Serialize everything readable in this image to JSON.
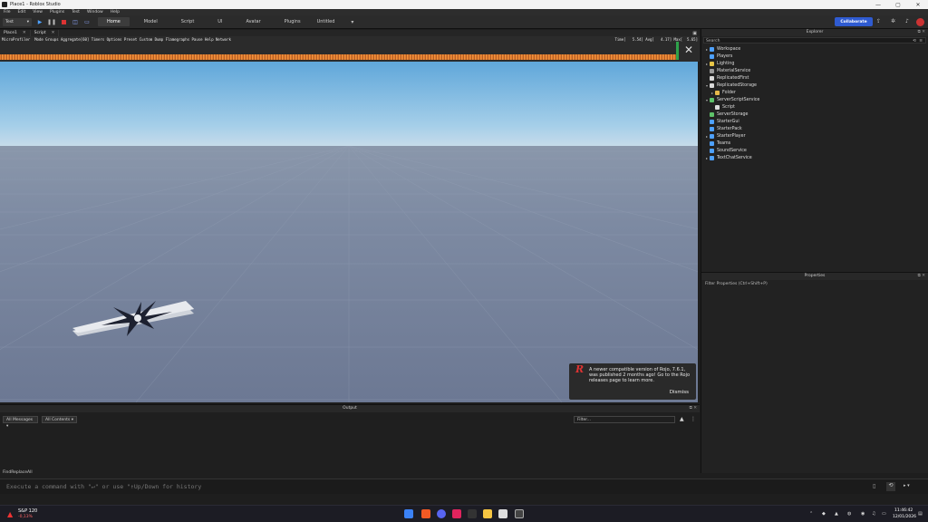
{
  "window": {
    "title": "Place1 - Roblox Studio",
    "controls": [
      "—",
      "▢",
      "✕"
    ]
  },
  "menu": [
    "File",
    "Edit",
    "View",
    "Plugins",
    "Test",
    "Window",
    "Help"
  ],
  "toolbar": {
    "mode": "Test",
    "tabs": [
      "Home",
      "Model",
      "Script",
      "UI",
      "Avatar",
      "Plugins",
      "Untitled"
    ],
    "active_tab": "Home",
    "collaborate": "Collaborate"
  },
  "doc_tabs": [
    {
      "label": "Place1"
    },
    {
      "label": "Script"
    }
  ],
  "microprofiler": {
    "menu": "MicroProfiler  Mode Groups Aggregate[60] Timers Options Preset Custom Dump Flamegraphs Pause Help Network",
    "stats": "Time[   5.54] Avg[   4.17] Max[  5.65]"
  },
  "rojo": {
    "logo": "R",
    "message": "A newer compatible version of Rojo, 7.6.1, was published 2 months ago! Go to the Rojo releases page to learn more.",
    "dismiss": "Dismiss"
  },
  "explorer": {
    "title": "Explorer",
    "search_placeholder": "Search",
    "items": [
      {
        "label": "Workspace",
        "arrow": "▸",
        "color": "#4ea1ff"
      },
      {
        "label": "Players",
        "arrow": "",
        "color": "#4ea1ff"
      },
      {
        "label": "Lighting",
        "arrow": "▸",
        "color": "#e8c547"
      },
      {
        "label": "MaterialService",
        "arrow": "",
        "color": "#9b9b9b"
      },
      {
        "label": "ReplicatedFirst",
        "arrow": "",
        "color": "#d9d9d9"
      },
      {
        "label": "ReplicatedStorage",
        "arrow": "▾",
        "color": "#d9d9d9"
      },
      {
        "label": "Folder",
        "arrow": "▸",
        "color": "#e6b84a",
        "indent": 1
      },
      {
        "label": "ServerScriptService",
        "arrow": "▾",
        "color": "#5ec26a"
      },
      {
        "label": "Script",
        "arrow": "",
        "color": "#dcdcdc",
        "indent": 1
      },
      {
        "label": "ServerStorage",
        "arrow": "",
        "color": "#5ec26a"
      },
      {
        "label": "StarterGui",
        "arrow": "",
        "color": "#4ea1ff"
      },
      {
        "label": "StarterPack",
        "arrow": "",
        "color": "#4ea1ff"
      },
      {
        "label": "StarterPlayer",
        "arrow": "▸",
        "color": "#4ea1ff"
      },
      {
        "label": "Teams",
        "arrow": "",
        "color": "#4ea1ff"
      },
      {
        "label": "SoundService",
        "arrow": "",
        "color": "#4ea1ff"
      },
      {
        "label": "TextChatService",
        "arrow": "▸",
        "color": "#4ea1ff"
      }
    ]
  },
  "properties": {
    "title": "Properties",
    "filter_placeholder": "Filter Properties (Ctrl+Shift+P)"
  },
  "output": {
    "title": "Output",
    "messages_filter": "All Messages",
    "contexts_filter": "All Contents",
    "filter_placeholder": "Filter..."
  },
  "find_replace": "FindReplaceAll",
  "command_bar": {
    "placeholder": "Execute a command with \"↵\" or use \"↑Up/Down for history"
  },
  "taskbar": {
    "stock": {
      "name": "S&P 120",
      "change": "-0,13%"
    },
    "time": "11:46:42",
    "date": "12/01/2026"
  }
}
